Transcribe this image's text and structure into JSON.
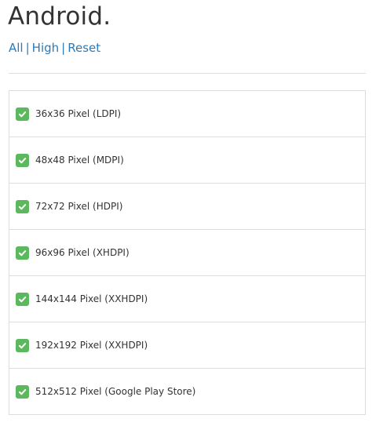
{
  "page": {
    "title": "Android."
  },
  "filters": {
    "all_label": "All",
    "high_label": "High",
    "reset_label": "Reset",
    "separator": "|"
  },
  "colors": {
    "link": "#2a7bb8",
    "check": "#5cb85c",
    "border": "#dddddd"
  },
  "icons": {
    "checkbox": "check-icon"
  },
  "items": [
    {
      "label": "36x36 Pixel (LDPI)",
      "checked": true
    },
    {
      "label": "48x48 Pixel (MDPI)",
      "checked": true
    },
    {
      "label": "72x72 Pixel (HDPI)",
      "checked": true
    },
    {
      "label": "96x96 Pixel (XHDPI)",
      "checked": true
    },
    {
      "label": "144x144 Pixel (XXHDPI)",
      "checked": true
    },
    {
      "label": "192x192 Pixel (XXHDPI)",
      "checked": true
    },
    {
      "label": "512x512 Pixel (Google Play Store)",
      "checked": true
    }
  ]
}
